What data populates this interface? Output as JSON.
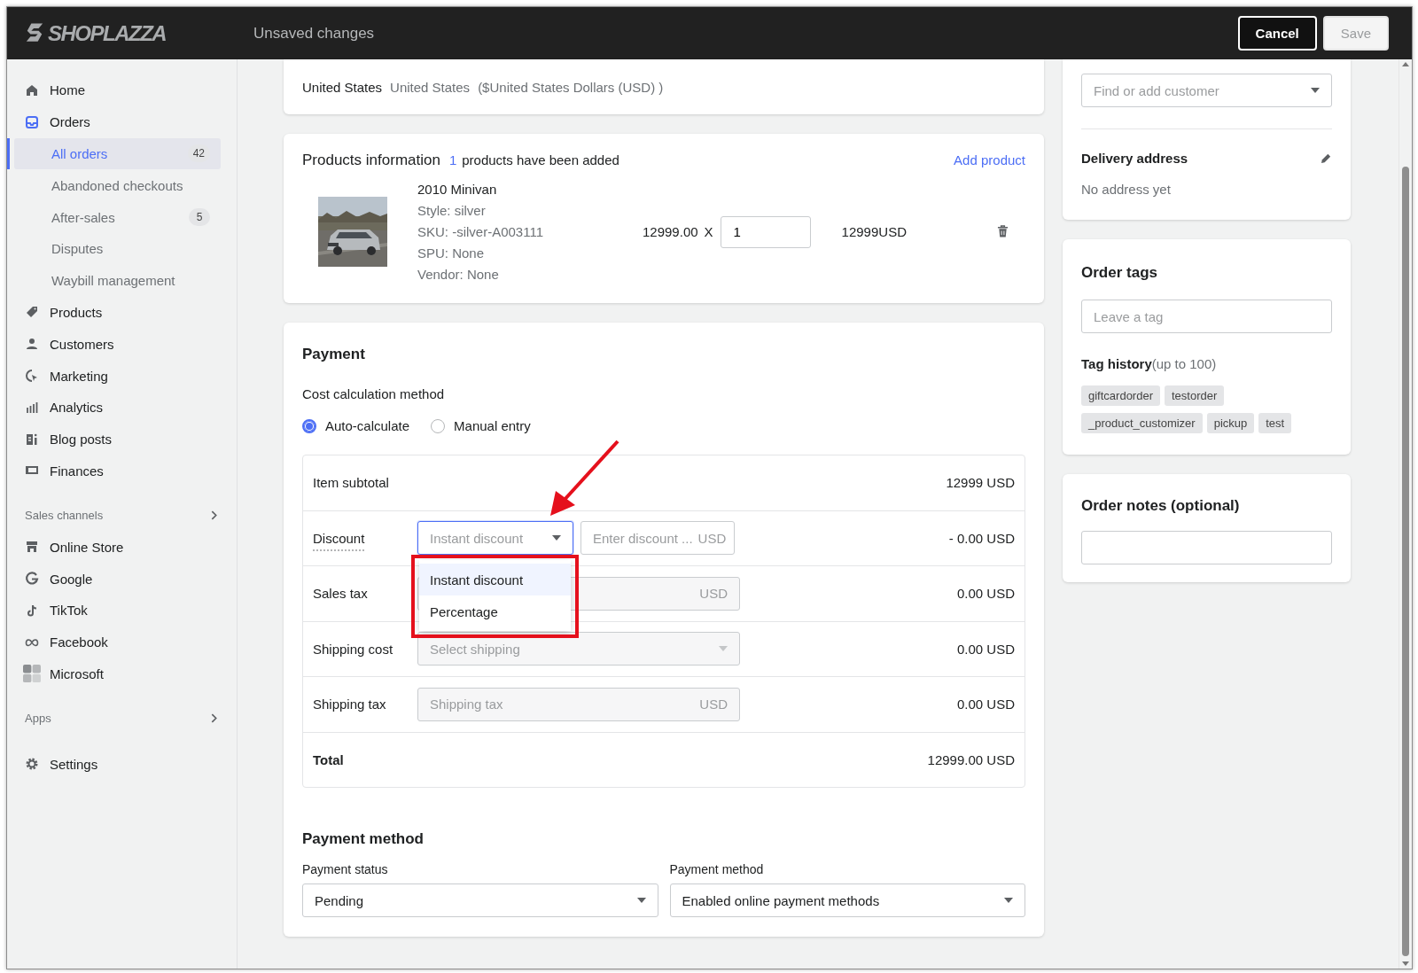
{
  "header": {
    "logo": "SHOPLAZZA",
    "title": "Unsaved changes",
    "buttons": [
      {
        "label": "Cancel",
        "disabled": false
      },
      {
        "label": "Save",
        "disabled": true
      }
    ]
  },
  "sidebar": {
    "items": [
      {
        "label": "Home",
        "selected": false
      },
      {
        "label": "Orders",
        "selected": false,
        "expanded": true,
        "children": [
          {
            "label": "All orders",
            "selected": true,
            "badge": "42"
          },
          {
            "label": "Abandoned checkouts",
            "selected": false
          },
          {
            "label": "After-sales",
            "selected": false,
            "badge": "5"
          },
          {
            "label": "Disputes",
            "selected": false
          },
          {
            "label": "Waybill management",
            "selected": false
          }
        ]
      },
      {
        "label": "Products",
        "selected": false
      },
      {
        "label": "Customers",
        "selected": false
      },
      {
        "label": "Marketing",
        "selected": false
      },
      {
        "label": "Analytics",
        "selected": false
      },
      {
        "label": "Blog posts",
        "selected": false
      },
      {
        "label": "Finances",
        "selected": false
      }
    ],
    "sections": [
      {
        "title": "Sales channels",
        "items": [
          {
            "label": "Online Store",
            "selected": false
          },
          {
            "label": "Google",
            "selected": false
          },
          {
            "label": "TikTok",
            "selected": false
          },
          {
            "label": "Facebook",
            "selected": false
          },
          {
            "label": "Microsoft",
            "selected": false
          }
        ]
      },
      {
        "title": "Apps"
      }
    ],
    "footer": [
      {
        "label": "Settings",
        "selected": false
      }
    ]
  },
  "market": {
    "country": "United States",
    "market": "United States",
    "currency": "($United States Dollars (USD) )"
  },
  "products": {
    "title": "Products information",
    "count": "1",
    "count_text": "products have been added",
    "add_link": "Add product",
    "items": [
      {
        "kind": "picture",
        "name": "2010 Minivan",
        "details": [
          "Style: silver",
          "SKU: -silver-A003111",
          "SPU: None",
          "Vendor: None"
        ],
        "price": "12999.00",
        "times": "X",
        "quantity": "1",
        "total": "12999USD"
      }
    ]
  },
  "payment": {
    "title": "Payment",
    "method_label": "Cost calculation method",
    "methods": [
      {
        "label": "Auto-calculate",
        "selected": true
      },
      {
        "label": "Manual entry",
        "selected": false
      }
    ],
    "rows": [
      {
        "kind": "plain",
        "label": "Item subtotal",
        "amount": "12999 USD"
      },
      {
        "kind": "discount",
        "label": "Discount",
        "select": {
          "placeholder": "Instant discount",
          "expanded": true,
          "options": [
            {
              "label": "Instant discount",
              "selected": true
            },
            {
              "label": "Percentage",
              "selected": false
            }
          ]
        },
        "input": {
          "placeholder": "Enter discount ...",
          "suffix": "USD"
        },
        "amount": "- 0.00 USD"
      },
      {
        "kind": "input",
        "label": "Sales tax",
        "input": {
          "suffix": "USD"
        },
        "amount": "0.00 USD"
      },
      {
        "kind": "select",
        "label": "Shipping cost",
        "select": {
          "placeholder": "Select shipping"
        },
        "amount": "0.00 USD"
      },
      {
        "kind": "input",
        "label": "Shipping tax",
        "input": {
          "placeholder": "Shipping tax",
          "suffix": "USD"
        },
        "amount": "0.00 USD"
      },
      {
        "kind": "total",
        "label": "Total",
        "amount": "12999.00 USD"
      }
    ]
  },
  "payment_method": {
    "title": "Payment method",
    "fields": [
      {
        "label": "Payment status",
        "value": "Pending"
      },
      {
        "label": "Payment method",
        "value": "Enabled online payment methods"
      }
    ]
  },
  "customer": {
    "search": {
      "placeholder": "Find or add customer"
    },
    "delivery": {
      "title": "Delivery address",
      "text": "No address yet"
    }
  },
  "order_tags": {
    "title": "Order tags",
    "input": {
      "placeholder": "Leave a tag"
    },
    "history_title": "Tag history",
    "history_note": "(up to 100)",
    "tags": [
      "giftcardorder",
      "testorder",
      "_product_customizer",
      "pickup",
      "test"
    ]
  },
  "order_notes": {
    "title": "Order notes (optional)"
  }
}
